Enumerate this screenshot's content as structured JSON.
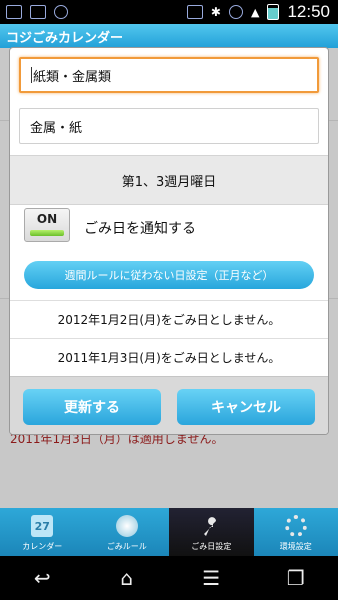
{
  "status": {
    "time": "12:50"
  },
  "app": {
    "title": "コジごみカレンダー"
  },
  "background": {
    "note": "2011年1月3日（月）は適用しません。"
  },
  "dialog": {
    "name_input": "紙類・金属類",
    "sub_input": "金属・紙",
    "week_rule": "第1、3週月曜日",
    "toggle": {
      "state": "ON",
      "label": "ごみ日を通知する"
    },
    "exception_button": "週間ルールに従わない日設定（正月など）",
    "exceptions": [
      "2012年1月2日(月)をごみ日としません。",
      "2011年1月3日(月)をごみ日としません。"
    ],
    "update_button": "更新する",
    "cancel_button": "キャンセル"
  },
  "tabs": [
    {
      "label": "カレンダー",
      "icon": "calendar-icon",
      "icon_text": "27"
    },
    {
      "label": "ごみルール",
      "icon": "globe-icon"
    },
    {
      "label": "ごみ日設定",
      "icon": "wrench-icon"
    },
    {
      "label": "環境設定",
      "icon": "gear-icon"
    }
  ],
  "colors": {
    "accent": "#27a6dc",
    "focus": "#f19a3a"
  }
}
